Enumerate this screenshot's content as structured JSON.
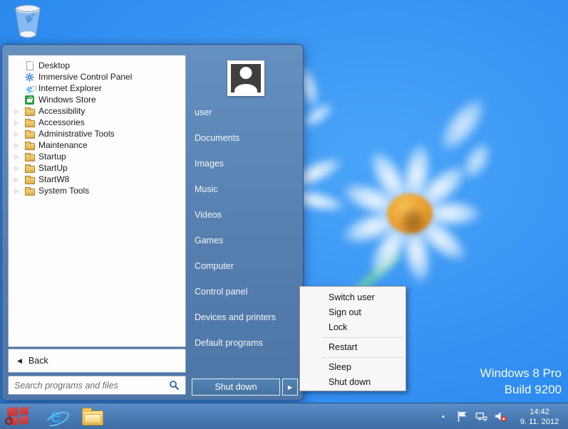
{
  "colors": {
    "desktop_blue": "#2F8CF0",
    "menu_blue": "#567FB0",
    "taskbar_blue": "#4A7CB5",
    "start_logo_red": "#C24444",
    "ie_blue": "#2EA3E8",
    "store_green": "#2E9E3E",
    "mute_badge_red": "#D3342C",
    "flower_center_orange": "#E89A28"
  },
  "icons": {
    "expander_glyph": "▷",
    "back_arrow_glyph": "◀",
    "shutdown_arrow_glyph": "▶",
    "tray_expand_glyph": "▲"
  },
  "start_menu": {
    "programs": [
      {
        "label": "Desktop",
        "icon": "document-icon"
      },
      {
        "label": "Immersive Control Panel",
        "icon": "gear-icon"
      },
      {
        "label": "Internet Explorer",
        "icon": "ie-icon"
      },
      {
        "label": "Windows Store",
        "icon": "store-icon"
      },
      {
        "label": "Accessibility",
        "icon": "folder-icon"
      },
      {
        "label": "Accessories",
        "icon": "folder-icon"
      },
      {
        "label": "Administrative Tools",
        "icon": "folder-icon"
      },
      {
        "label": "Maintenance",
        "icon": "folder-icon"
      },
      {
        "label": "Startup",
        "icon": "folder-icon"
      },
      {
        "label": "StartUp",
        "icon": "folder-icon"
      },
      {
        "label": "StartW8",
        "icon": "folder-icon"
      },
      {
        "label": "System Tools",
        "icon": "folder-icon"
      }
    ],
    "back_label": "Back",
    "search_placeholder": "Search programs and files",
    "user_name": "user",
    "right_items": [
      "Documents",
      "Images",
      "Music",
      "Videos",
      "Games",
      "Computer",
      "Control panel",
      "Devices and printers",
      "Default programs"
    ],
    "shutdown_label": "Shut down"
  },
  "power_menu": {
    "groups": [
      {
        "items": [
          "Switch user",
          "Sign out",
          "Lock"
        ]
      },
      {
        "items": [
          "Restart"
        ]
      },
      {
        "items": [
          "Sleep",
          "Shut down"
        ]
      }
    ]
  },
  "taskbar": {
    "clock_time": "14:42",
    "clock_date": "9. 11. 2012"
  },
  "desktop": {
    "watermark_line1": "Windows 8 Pro",
    "watermark_line2": "Build 9200"
  }
}
